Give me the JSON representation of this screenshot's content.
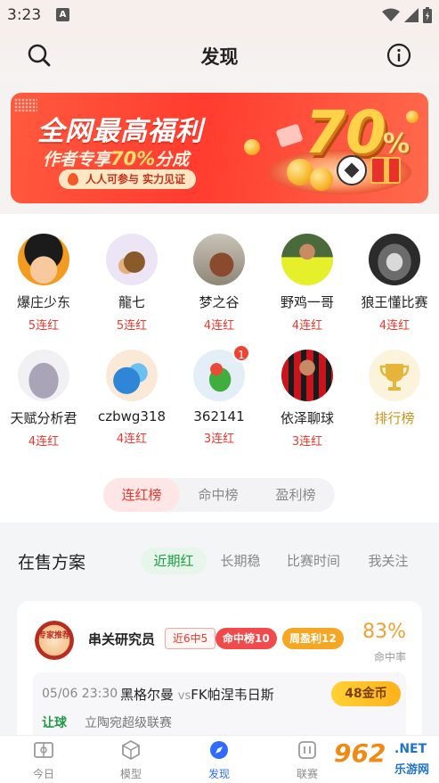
{
  "status_bar": {
    "time": "3:23",
    "notif_letter": "A"
  },
  "header": {
    "title": "发现"
  },
  "banner": {
    "headline": "全网最高福利",
    "subline_prefix": "作者专享",
    "subline_highlight": "70%",
    "subline_suffix": "分成",
    "pill": "人人可参与  实力见证",
    "big_number": "70",
    "percent_sign": "%"
  },
  "experts": [
    {
      "name": "爆庄少东",
      "streak": "5连红"
    },
    {
      "name": "龍七",
      "streak": "5连红"
    },
    {
      "name": "梦之谷",
      "streak": "4连红"
    },
    {
      "name": "野鸡一哥",
      "streak": "4连红"
    },
    {
      "name": "狼王懂比赛",
      "streak": "4连红"
    },
    {
      "name": "天赋分析君",
      "streak": "4连红"
    },
    {
      "name": "czbwg318",
      "streak": "4连红"
    },
    {
      "name": "362141",
      "streak": "3连红",
      "badge": "1"
    },
    {
      "name": "依泽聊球",
      "streak": "3连红"
    }
  ],
  "leaderboard_entry": {
    "label": "排行榜"
  },
  "ranking_tabs": [
    {
      "label": "连红榜",
      "active": true
    },
    {
      "label": "命中榜",
      "active": false
    },
    {
      "label": "盈利榜",
      "active": false
    }
  ],
  "plans": {
    "title": "在售方案",
    "filters": [
      {
        "label": "近期红",
        "active": true
      },
      {
        "label": "长期稳",
        "active": false
      },
      {
        "label": "比赛时间",
        "active": false
      },
      {
        "label": "我关注",
        "active": false
      }
    ],
    "card": {
      "seal_text": "专家推荐",
      "author": "串关研究员",
      "tags": [
        "近6中5",
        "命中榜10",
        "周盈利12"
      ],
      "hit_rate": "83%",
      "hit_rate_label": "命中率",
      "match": {
        "time": "05/06 23:30",
        "home": "黑格尔曼",
        "vs": "vs",
        "away": "FK帕涅韦日斯",
        "price": "48金币",
        "kind": "让球",
        "league": "立陶宛超级联赛"
      }
    }
  },
  "bottom_nav": [
    {
      "label": "今日",
      "icon": "stadium-icon",
      "active": false
    },
    {
      "label": "模型",
      "icon": "cube-icon",
      "active": false
    },
    {
      "label": "发现",
      "icon": "compass-icon",
      "active": true
    },
    {
      "label": "联赛",
      "icon": "league-icon",
      "active": false
    }
  ],
  "watermark": {
    "brand": "962",
    "domain": ".NET",
    "site": "乐游网"
  },
  "colors": {
    "accent_red": "#e8392e",
    "accent_green": "#1f9a44",
    "nav_active": "#2f6bff",
    "gold": "#c99320"
  }
}
